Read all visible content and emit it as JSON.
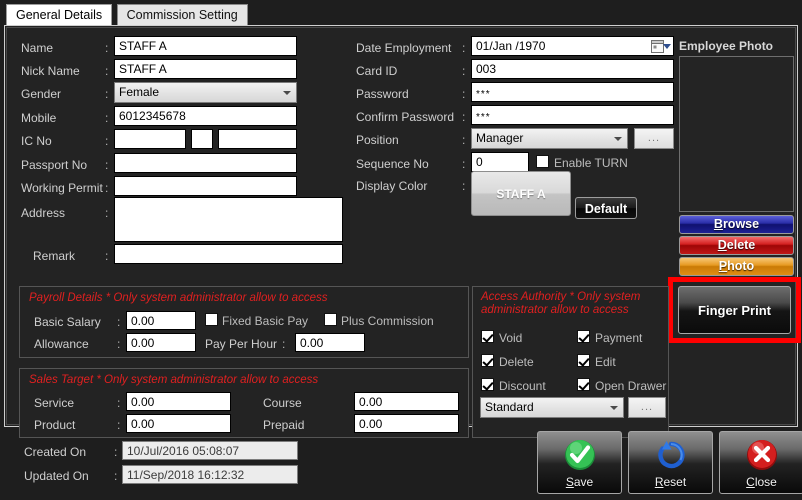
{
  "tabs": [
    {
      "label": "General Details",
      "active": true
    },
    {
      "label": "Commission Setting",
      "active": false
    }
  ],
  "left_form": {
    "name": {
      "label": "Name",
      "value": "STAFF A"
    },
    "nick_name": {
      "label": "Nick Name",
      "value": "STAFF A"
    },
    "gender": {
      "label": "Gender",
      "value": "Female"
    },
    "mobile": {
      "label": "Mobile",
      "value": "6012345678"
    },
    "ic_no": {
      "label": "IC No",
      "part1": "",
      "part2": "",
      "part3": ""
    },
    "passport_no": {
      "label": "Passport No",
      "value": ""
    },
    "working_permit": {
      "label": "Working Permit",
      "value": ""
    },
    "address": {
      "label": "Address",
      "value": ""
    },
    "remark": {
      "label": "Remark",
      "value": ""
    }
  },
  "mid_form": {
    "date_employment": {
      "label": "Date Employment",
      "value": "01/Jan /1970",
      "icon": "calendar-icon"
    },
    "card_id": {
      "label": "Card ID",
      "value": "003"
    },
    "password": {
      "label": "Password",
      "value": "***"
    },
    "confirm_password": {
      "label": "Confirm Password",
      "value": "***"
    },
    "position": {
      "label": "Position",
      "value": "Manager",
      "browse_label": "..."
    },
    "sequence_no": {
      "label": "Sequence No",
      "value": "0"
    },
    "enable_turn": {
      "label": "Enable TURN",
      "checked": false
    },
    "display_color": {
      "label": "Display Color",
      "swatch_text": "STAFF A",
      "default_label": "Default"
    }
  },
  "photo_panel": {
    "title": "Employee Photo",
    "buttons": [
      {
        "name": "browse",
        "label": "Browse",
        "accent": "#2a2ea8"
      },
      {
        "name": "delete",
        "label": "Delete",
        "accent": "#d42020"
      },
      {
        "name": "photo",
        "label": "Photo",
        "accent": "#e79a22"
      },
      {
        "name": "finger-print",
        "label": "Finger Print",
        "accent": "#151515"
      }
    ],
    "highlight_color": "#ff0000"
  },
  "payroll": {
    "title": "Payroll Details * Only system administrator allow to access",
    "basic_salary": {
      "label": "Basic Salary",
      "value": "0.00"
    },
    "fixed_basic_pay": {
      "label": "Fixed Basic Pay",
      "checked": false
    },
    "plus_commission": {
      "label": "Plus Commission",
      "checked": false
    },
    "allowance": {
      "label": "Allowance",
      "value": "0.00"
    },
    "pay_per_hour": {
      "label": "Pay Per Hour",
      "value": "0.00"
    }
  },
  "sales_target": {
    "title": "Sales Target * Only system administrator allow to access",
    "service": {
      "label": "Service",
      "value": "0.00"
    },
    "course": {
      "label": "Course",
      "value": "0.00"
    },
    "product": {
      "label": "Product",
      "value": "0.00"
    },
    "prepaid": {
      "label": "Prepaid",
      "value": "0.00"
    }
  },
  "access_authority": {
    "title": "Access Authority * Only system administrator allow to access",
    "checks": [
      {
        "label": "Void",
        "checked": true
      },
      {
        "label": "Payment",
        "checked": true
      },
      {
        "label": "Delete",
        "checked": true
      },
      {
        "label": "Edit",
        "checked": true
      },
      {
        "label": "Discount",
        "checked": true
      },
      {
        "label": "Open Drawer",
        "checked": true
      }
    ],
    "level": {
      "value": "Standard",
      "browse_label": "..."
    }
  },
  "footer": {
    "created_on": {
      "label": "Created On",
      "value": "10/Jul/2016 05:08:07"
    },
    "updated_on": {
      "label": "Updated On",
      "value": "11/Sep/2018 16:12:32"
    },
    "actions": [
      {
        "name": "save",
        "label": "Save",
        "accel": "S",
        "icon": "check-circle-icon",
        "color": "#22b44a"
      },
      {
        "name": "reset",
        "label": "Reset",
        "accel": "R",
        "icon": "refresh-arrow-icon",
        "color": "#1b62d6"
      },
      {
        "name": "close",
        "label": "Close",
        "accel": "C",
        "icon": "x-circle-icon",
        "color": "#d01b1b"
      }
    ]
  }
}
